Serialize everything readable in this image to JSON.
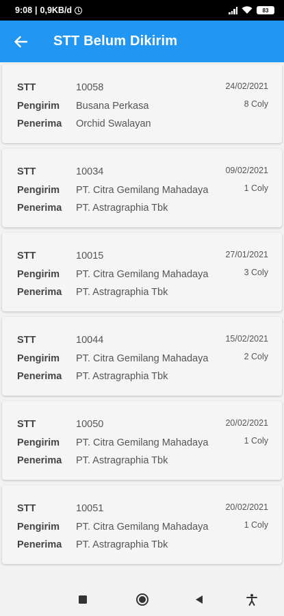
{
  "status_bar": {
    "time": "9:08",
    "net_speed": "0,9KB/d",
    "battery": "83"
  },
  "app_bar": {
    "title": "STT Belum Dikirim"
  },
  "labels": {
    "stt": "STT",
    "pengirim": "Pengirim",
    "penerima": "Penerima"
  },
  "cards": [
    {
      "stt": "10058",
      "pengirim": "Busana Perkasa",
      "penerima": "Orchid Swalayan",
      "date": "24/02/2021",
      "coly": "8 Coly"
    },
    {
      "stt": "10034",
      "pengirim": "PT. Citra Gemilang Mahadaya",
      "penerima": "PT. Astragraphia Tbk",
      "date": "09/02/2021",
      "coly": "1 Coly"
    },
    {
      "stt": "10015",
      "pengirim": "PT. Citra Gemilang Mahadaya",
      "penerima": "PT. Astragraphia Tbk",
      "date": "27/01/2021",
      "coly": "3 Coly"
    },
    {
      "stt": "10044",
      "pengirim": "PT. Citra Gemilang Mahadaya",
      "penerima": "PT. Astragraphia Tbk",
      "date": "15/02/2021",
      "coly": "2 Coly"
    },
    {
      "stt": "10050",
      "pengirim": "PT. Citra Gemilang Mahadaya",
      "penerima": "PT. Astragraphia Tbk",
      "date": "20/02/2021",
      "coly": "1 Coly"
    },
    {
      "stt": "10051",
      "pengirim": "PT. Citra Gemilang Mahadaya",
      "penerima": "PT. Astragraphia Tbk",
      "date": "20/02/2021",
      "coly": "1 Coly"
    }
  ],
  "colors": {
    "primary": "#2196f3",
    "status_bar": "#000000",
    "background": "#f2f2f2"
  },
  "icons": [
    "alarm-icon",
    "signal-icon",
    "wifi-icon",
    "battery-icon",
    "back-arrow-icon",
    "nav-recents-icon",
    "nav-home-icon",
    "nav-back-icon",
    "accessibility-icon"
  ]
}
